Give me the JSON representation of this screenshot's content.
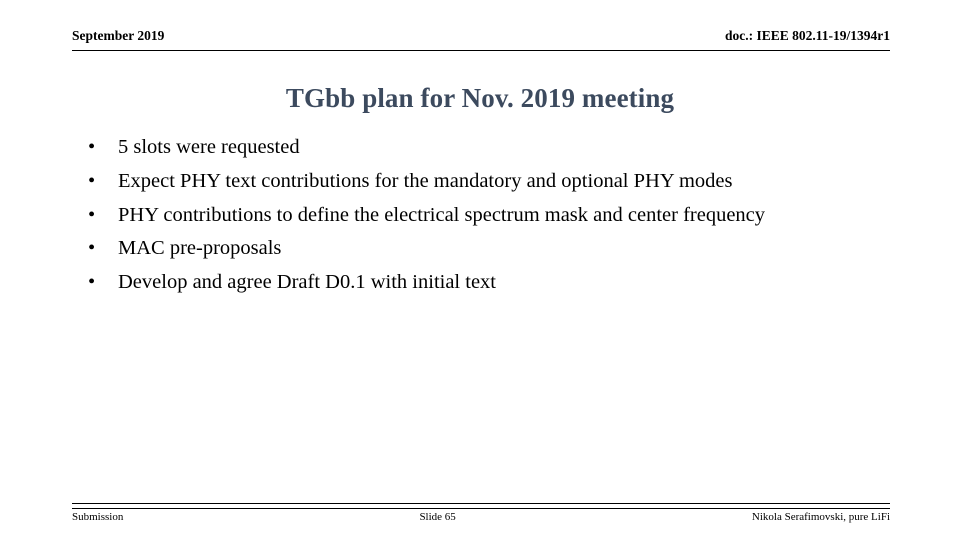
{
  "header": {
    "date": "September 2019",
    "doc_reference": "doc.: IEEE 802.11-19/1394r1"
  },
  "title": "TGbb plan for Nov. 2019 meeting",
  "title_color": "#3c4a5e",
  "bullets": [
    {
      "marker": "•",
      "text": "5 slots were requested"
    },
    {
      "marker": "•",
      "text": "Expect PHY text contributions for the mandatory and optional PHY modes"
    },
    {
      "marker": "•",
      "text": "PHY contributions to define the electrical spectrum mask and center frequency"
    },
    {
      "marker": "•",
      "text": "MAC pre-proposals"
    },
    {
      "marker": "•",
      "text": "Develop and agree Draft D0.1 with initial text"
    }
  ],
  "footer": {
    "left": "Submission",
    "center": "Slide 65",
    "right": "Nikola Serafimovski, pure LiFi"
  }
}
